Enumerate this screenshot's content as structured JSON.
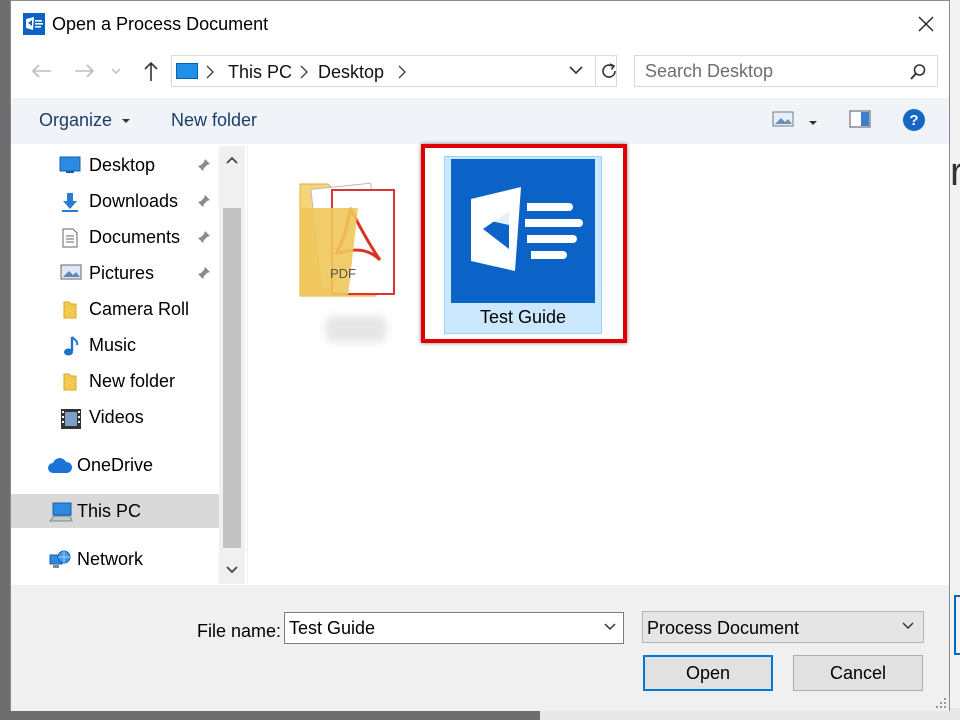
{
  "window": {
    "title": "Open a Process Document"
  },
  "address": {
    "crumbs": [
      "This PC",
      "Desktop"
    ]
  },
  "search": {
    "placeholder": "Search Desktop"
  },
  "toolbar": {
    "organize": "Organize",
    "new_folder": "New folder"
  },
  "nav": {
    "items": [
      {
        "label": "Desktop"
      },
      {
        "label": "Downloads"
      },
      {
        "label": "Documents"
      },
      {
        "label": "Pictures"
      },
      {
        "label": "Camera Roll"
      },
      {
        "label": "Music"
      },
      {
        "label": "New folder"
      },
      {
        "label": "Videos"
      },
      {
        "label": "OneDrive"
      },
      {
        "label": "This PC"
      },
      {
        "label": "Network"
      }
    ]
  },
  "files": [
    {
      "name": "Test Guide"
    }
  ],
  "pdf_badge": "PDF",
  "footer": {
    "file_name_label": "File name:",
    "file_name_value": "Test Guide",
    "file_type": "Process Document",
    "open_label": "Open",
    "cancel_label": "Cancel"
  },
  "colors": {
    "accent": "#0078d7",
    "app_blue": "#0c63c7",
    "highlight_red": "#e00000",
    "selection": "#cce8ff"
  }
}
